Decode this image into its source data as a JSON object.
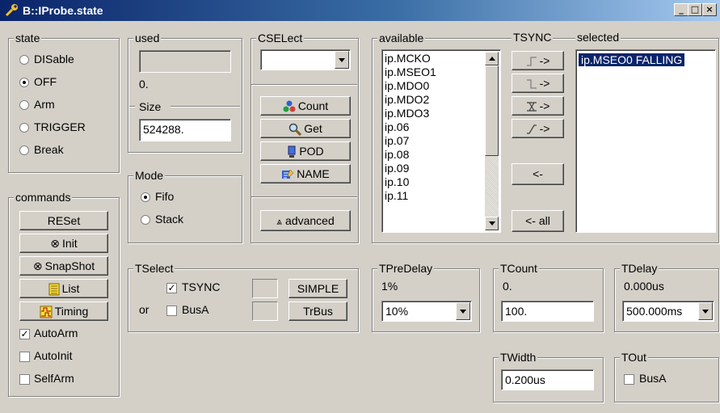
{
  "window": {
    "title": "B::IProbe.state"
  },
  "state": {
    "label": "state",
    "options": [
      {
        "label": "DISable",
        "selected": false
      },
      {
        "label": "OFF",
        "selected": true
      },
      {
        "label": "Arm",
        "selected": false
      },
      {
        "label": "TRIGGER",
        "selected": false
      },
      {
        "label": "Break",
        "selected": false
      }
    ]
  },
  "used": {
    "label": "used",
    "value": "",
    "count": "0."
  },
  "size": {
    "label": "Size",
    "value": "524288."
  },
  "mode": {
    "label": "Mode",
    "options": [
      {
        "label": "Fifo",
        "selected": true
      },
      {
        "label": "Stack",
        "selected": false
      }
    ]
  },
  "cselect": {
    "label": "CSELect",
    "value": ""
  },
  "buttons": {
    "count": "Count",
    "get": "Get",
    "pod": "POD",
    "name": "NAME",
    "advanced": "advanced"
  },
  "available": {
    "label": "available",
    "items": [
      "ip.MCKO",
      "ip.MSEO1",
      "ip.MDO0",
      "ip.MDO2",
      "ip.MDO3",
      "ip.06",
      "ip.07",
      "ip.08",
      "ip.09",
      "ip.10",
      "ip.11"
    ]
  },
  "tsync": {
    "label": "TSYNC",
    "arrows": [
      "->",
      "->",
      "->",
      "->"
    ],
    "remove": "<-",
    "remove_all": "<- all"
  },
  "selected": {
    "label": "selected",
    "items": [
      "ip.MSEO0 FALLING"
    ]
  },
  "commands": {
    "label": "commands",
    "reset": "RESet",
    "init": "Init",
    "snapshot": "SnapShot",
    "list": "List",
    "timing": "Timing",
    "autoarm": "AutoArm",
    "autoinit": "AutoInit",
    "selfarm": "SelfArm"
  },
  "tselect": {
    "label": "TSelect",
    "tsync": "TSYNC",
    "or": "or",
    "busa": "BusA",
    "simple": "SIMPLE",
    "trbus": "TrBus"
  },
  "tpredelay": {
    "label": "TPreDelay",
    "value": "1%",
    "select": "10%"
  },
  "tcount": {
    "label": "TCount",
    "value": "0.",
    "field": "100."
  },
  "tdelay": {
    "label": "TDelay",
    "value": "0.000us",
    "select": "500.000ms"
  },
  "twidth": {
    "label": "TWidth",
    "field": "0.200us"
  },
  "tout": {
    "label": "TOut",
    "busa": "BusA"
  }
}
